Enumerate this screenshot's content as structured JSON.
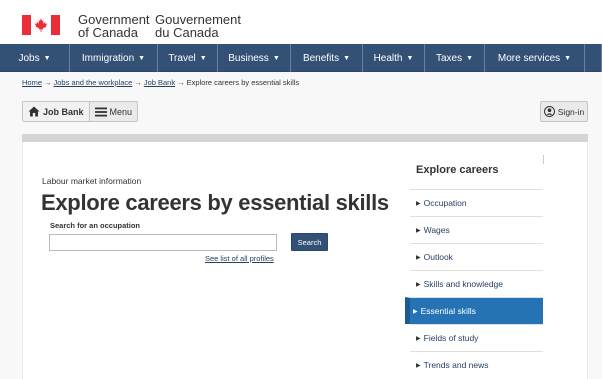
{
  "header": {
    "gov_en_line1": "Government",
    "gov_en_line2": "of Canada",
    "gov_fr_line1": "Gouvernement",
    "gov_fr_line2": "du Canada",
    "flag_color": "#eb2d37"
  },
  "nav": {
    "items": [
      {
        "label": "Jobs"
      },
      {
        "label": "Immigration"
      },
      {
        "label": "Travel"
      },
      {
        "label": "Business"
      },
      {
        "label": "Benefits"
      },
      {
        "label": "Health"
      },
      {
        "label": "Taxes"
      },
      {
        "label": "More services"
      }
    ],
    "chevron": "▼",
    "background": "#335075"
  },
  "breadcrumb": {
    "items": [
      "Home",
      "Jobs and the workplace",
      "Job Bank"
    ],
    "current": "Explore careers by essential skills",
    "separator": "→"
  },
  "jobbank": {
    "home_label": "Job Bank",
    "menu_label": "Menu",
    "signin_label": "Sign-in",
    "home_icon": "home-icon",
    "menu_icon": "hamburger-icon",
    "signin_icon": "user-circle-icon"
  },
  "main": {
    "kicker": "Labour market information",
    "title": "Explore careers by essential skills",
    "search_label": "Search for an occupation",
    "search_value": "",
    "search_button": "Search",
    "see_list": "See list of all profiles"
  },
  "sidebar": {
    "title": "Explore careers",
    "items": [
      {
        "label": "Occupation",
        "active": false
      },
      {
        "label": "Wages",
        "active": false
      },
      {
        "label": "Outlook",
        "active": false
      },
      {
        "label": "Skills and knowledge",
        "active": false
      },
      {
        "label": "Essential skills",
        "active": true
      },
      {
        "label": "Fields of study",
        "active": false
      },
      {
        "label": "Trends and news",
        "active": false
      }
    ],
    "active_color": "#2572b4"
  }
}
